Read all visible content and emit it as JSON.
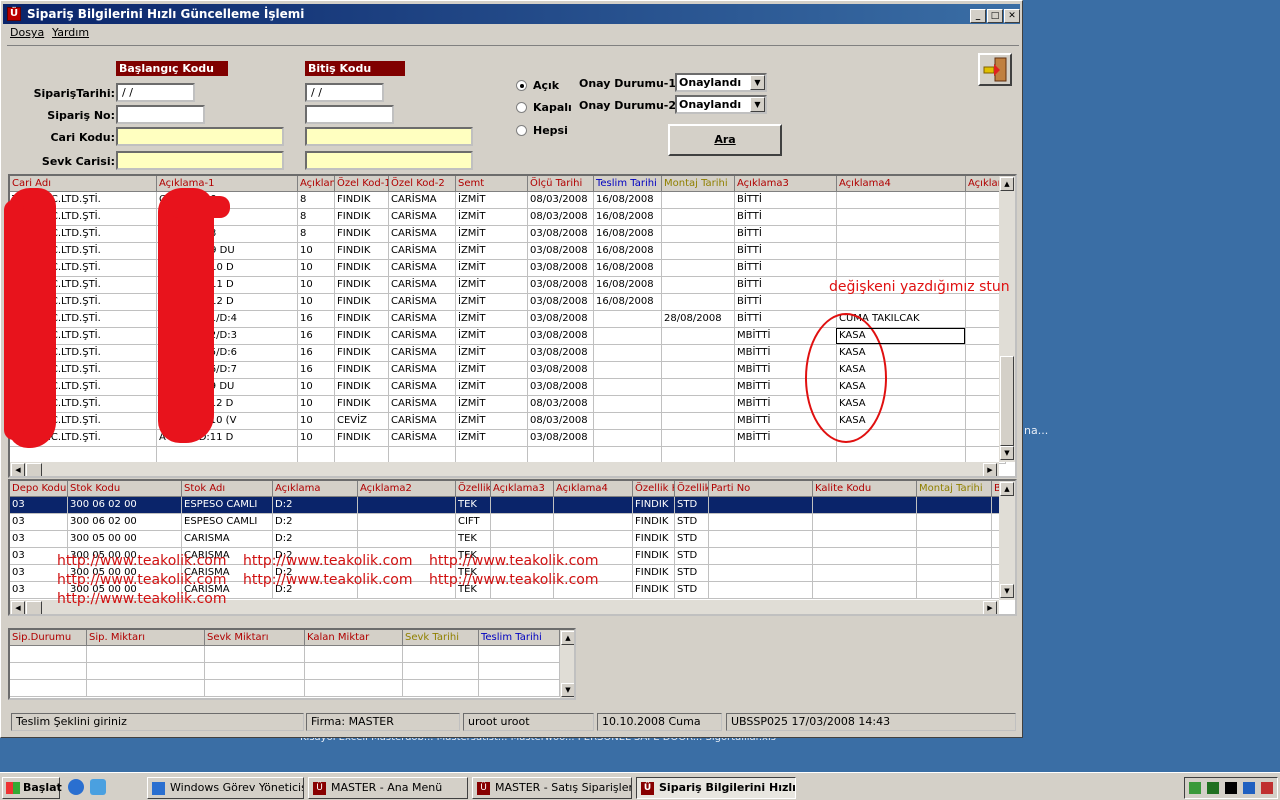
{
  "window": {
    "title": "Sipariş Bilgilerini Hızlı Güncelleme İşlemi",
    "icon_letter": "Ü",
    "min": "_",
    "max": "□",
    "close": "✕"
  },
  "menu": [
    "Dosya",
    "Yardım"
  ],
  "form": {
    "start_header": "Başlangıç Kodu",
    "end_header": "Bitiş Kodu",
    "labels": [
      "SiparişTarihi:",
      "Sipariş No:",
      "Cari Kodu:",
      "Sevk Carisi:"
    ],
    "start_date": "/ /",
    "end_date": "/ /",
    "radios": [
      {
        "label": "Açık",
        "checked": true
      },
      {
        "label": "Kapalı",
        "checked": false
      },
      {
        "label": "Hepsi",
        "checked": false
      }
    ],
    "onay1_label": "Onay Durumu-1:",
    "onay2_label": "Onay Durumu-2:",
    "onay1_value": "Onaylandı",
    "onay2_value": "Onaylandı",
    "search_button": "Ara"
  },
  "grid1": {
    "headers": [
      {
        "t": "Cari Adı",
        "c": "#b00000"
      },
      {
        "t": "Açıklama-1",
        "c": "#b00000"
      },
      {
        "t": "Açıklama",
        "c": "#b00000"
      },
      {
        "t": "Özel Kod-1",
        "c": "#b00000"
      },
      {
        "t": "Özel Kod-2",
        "c": "#b00000"
      },
      {
        "t": "Semt",
        "c": "#b00000"
      },
      {
        "t": "Ölçü Tarihi",
        "c": "#b00000"
      },
      {
        "t": "Teslim Tarihi",
        "c": "#0000c0"
      },
      {
        "t": "Montaj Tarihi",
        "c": "#908000"
      },
      {
        "t": "Açıklama3",
        "c": "#b00000"
      },
      {
        "t": "Açıklama4",
        "c": "#b00000"
      },
      {
        "t": "Açıklam",
        "c": "#b00000"
      }
    ],
    "rows": [
      [
        "TAAH.TİC.LTD.ŞTİ.",
        "C BLOK D:6",
        "8",
        "FINDIK",
        "CARİSMA",
        "İZMİT",
        "08/03/2008",
        "16/08/2008",
        "",
        "BİTTİ",
        "",
        ""
      ],
      [
        "TAAH.TİC.LTD.ŞTİ.",
        "C BLOK D:7",
        "8",
        "FINDIK",
        "CARİSMA",
        "İZMİT",
        "08/03/2008",
        "16/08/2008",
        "",
        "BİTTİ",
        "",
        ""
      ],
      [
        "TAAH.TİC.LTD.ŞTİ.",
        "C BLOK D:8",
        "8",
        "FINDIK",
        "CARİSMA",
        "İZMİT",
        "03/08/2008",
        "16/08/2008",
        "",
        "BİTTİ",
        "",
        ""
      ],
      [
        "TAAH.TİC.LTD.ŞTİ.",
        "C/BLOK D:9 DU",
        "10",
        "FINDIK",
        "CARİSMA",
        "İZMİT",
        "03/08/2008",
        "16/08/2008",
        "",
        "BİTTİ",
        "",
        ""
      ],
      [
        "TAAH.TİC.LTD.ŞTİ.",
        "C/BLOK D:10 D",
        "10",
        "FINDIK",
        "CARİSMA",
        "İZMİT",
        "03/08/2008",
        "16/08/2008",
        "",
        "BİTTİ",
        "",
        ""
      ],
      [
        "TAAH.TİC.LTD.ŞTİ.",
        "C/BLOK D:11 D",
        "10",
        "FINDIK",
        "CARİSMA",
        "İZMİT",
        "03/08/2008",
        "16/08/2008",
        "",
        "BİTTİ",
        "",
        ""
      ],
      [
        "TAAH.TİC.LTD.ŞTİ.",
        "C/BLOK D:12 D",
        "10",
        "FINDIK",
        "CARİSMA",
        "İZMİT",
        "03/08/2008",
        "16/08/2008",
        "",
        "BİTTİ",
        "",
        ""
      ],
      [
        "TAAH.TİC.LTD.ŞTİ.",
        "A BLOK D:1/D:4",
        "16",
        "FINDIK",
        "CARİSMA",
        "İZMİT",
        "03/08/2008",
        "",
        "28/08/2008",
        "BİTTİ",
        "CUMA TAKILCAK",
        ""
      ],
      [
        "TAAH.TİC.LTD.ŞTİ.",
        "A BLOK D:2/D:3",
        "16",
        "FINDIK",
        "CARİSMA",
        "İZMİT",
        "03/08/2008",
        "",
        "",
        "MBİTTİ",
        "KASA",
        ""
      ],
      [
        "TAAH.TİC.LTD.ŞTİ.",
        "A BLOK D:5/D:6",
        "16",
        "FINDIK",
        "CARİSMA",
        "İZMİT",
        "03/08/2008",
        "",
        "",
        "MBİTTİ",
        "KASA",
        ""
      ],
      [
        "TAAH.TİC.LTD.ŞTİ.",
        "A BLOK D:6/D:7",
        "16",
        "FINDIK",
        "CARİSMA",
        "İZMİT",
        "03/08/2008",
        "",
        "",
        "MBİTTİ",
        "KASA",
        ""
      ],
      [
        "TAAH.TİC.LTD.ŞTİ.",
        "A BLOK D:9 DU",
        "10",
        "FINDIK",
        "CARİSMA",
        "İZMİT",
        "03/08/2008",
        "",
        "",
        "MBİTTİ",
        "KASA",
        ""
      ],
      [
        "TAAH.TİC.LTD.ŞTİ.",
        "A BLOK D:12 D",
        "10",
        "FINDIK",
        "CARİSMA",
        "İZMİT",
        "08/03/2008",
        "",
        "",
        "MBİTTİ",
        "KASA",
        ""
      ],
      [
        "TAAH.TİC.LTD.ŞTİ.",
        "A BLOK D:10 (V",
        "10",
        "CEVİZ",
        "CARİSMA",
        "İZMİT",
        "08/03/2008",
        "",
        "",
        "MBİTTİ",
        "KASA",
        ""
      ],
      [
        "TAAH.TİC.LTD.ŞTİ.",
        "A BLOK D:11 D",
        "10",
        "FINDIK",
        "CARİSMA",
        "İZMİT",
        "03/08/2008",
        "",
        "",
        "MBİTTİ",
        "",
        ""
      ]
    ]
  },
  "annotation": "değişkeni yazdığımız stun",
  "grid2": {
    "headers": [
      {
        "t": "Depo Kodu",
        "c": "#b00000"
      },
      {
        "t": "Stok Kodu",
        "c": "#b00000"
      },
      {
        "t": "Stok Adı",
        "c": "#b00000"
      },
      {
        "t": "Açıklama",
        "c": "#b00000"
      },
      {
        "t": "Açıklama2",
        "c": "#b00000"
      },
      {
        "t": "Özellik",
        "c": "#b00000"
      },
      {
        "t": "Açıklama3",
        "c": "#b00000"
      },
      {
        "t": "Açıklama4",
        "c": "#b00000"
      },
      {
        "t": "Özellik K",
        "c": "#b00000"
      },
      {
        "t": "Özellik",
        "c": "#b00000"
      },
      {
        "t": "Parti No",
        "c": "#b00000"
      },
      {
        "t": "Kalite Kodu",
        "c": "#b00000"
      },
      {
        "t": "Montaj  Tarihi",
        "c": "#908000"
      },
      {
        "t": "B",
        "c": "#b00000"
      }
    ],
    "rows": [
      [
        "03",
        "300 06 02 00",
        "ESPESO CAMLI",
        "D:2",
        "",
        "TEK",
        "",
        "",
        "FINDIK",
        "STD",
        "",
        "",
        "",
        ""
      ],
      [
        "03",
        "300 06 02 00",
        "ESPESO CAMLI",
        "D:2",
        "",
        "CIFT",
        "",
        "",
        "FINDIK",
        "STD",
        "",
        "",
        "",
        ""
      ],
      [
        "03",
        "300 05 00 00",
        "CARISMA",
        "D:2",
        "",
        "TEK",
        "",
        "",
        "FINDIK",
        "STD",
        "",
        "",
        "",
        ""
      ],
      [
        "03",
        "300 05 00 00",
        "CARISMA",
        "D:2",
        "",
        "TEK",
        "",
        "",
        "FINDIK",
        "STD",
        "",
        "",
        "",
        ""
      ],
      [
        "03",
        "300 05 00 00",
        "CARISMA",
        "D:2",
        "",
        "TEK",
        "",
        "",
        "FINDIK",
        "STD",
        "",
        "",
        "",
        ""
      ],
      [
        "03",
        "300 05 00 00",
        "CARISMA",
        "D:2",
        "",
        "TEK",
        "",
        "",
        "FINDIK",
        "STD",
        "",
        "",
        "",
        ""
      ]
    ]
  },
  "watermarks": [
    "http://www.teakolik.com",
    "http://www.teakolik.com",
    "http://www.teakolik.com",
    "http://www.teakolik.com",
    "http://www.teakolik.com",
    "http://www.teakolik.com",
    "http://www.teakolik.com"
  ],
  "grid3": {
    "headers": [
      {
        "t": "Sip.Durumu",
        "c": "#b00000"
      },
      {
        "t": "Sip. Miktarı",
        "c": "#b00000"
      },
      {
        "t": "Sevk Miktarı",
        "c": "#b00000"
      },
      {
        "t": "Kalan Miktar",
        "c": "#b00000"
      },
      {
        "t": "Sevk Tarihi",
        "c": "#908000"
      },
      {
        "t": "Teslim Tarihi",
        "c": "#0000c0"
      }
    ]
  },
  "status": [
    "Teslim Şeklini giriniz",
    "Firma: MASTER",
    "uroot uroot",
    "10.10.2008  Cuma",
    "UBSSP025 17/03/2008 14:43"
  ],
  "desktop": {
    "icon_labels": "Kisayol Excell    Masterdob...    Mastersatist...    Masterwoo...      PERSONEL                                    SAPE DOOR...   Sigortalilar.xls",
    "side_label": "na..."
  },
  "taskbar": {
    "start": "Başlat",
    "tasks": [
      "Windows Görev Yöneticisi",
      "MASTER - Ana Menü",
      "MASTER - Satış Siparişler...",
      "Sipariş Bilgilerini Hızlı ..."
    ]
  }
}
